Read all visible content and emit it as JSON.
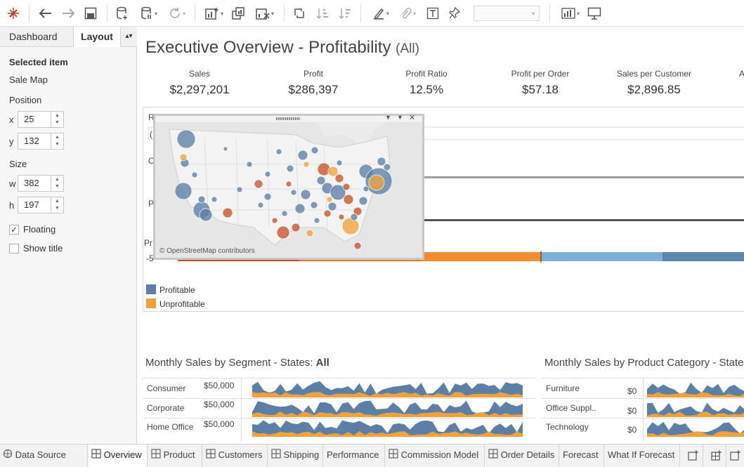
{
  "left_pane": {
    "tab_dashboard": "Dashboard",
    "tab_layout": "Layout",
    "selected_item_heading": "Selected item",
    "selected_item_value": "Sale Map",
    "position_heading": "Position",
    "x_label": "x",
    "x_value": "25",
    "y_label": "y",
    "y_value": "132",
    "size_heading": "Size",
    "w_label": "w",
    "w_value": "382",
    "h_label": "h",
    "h_value": "197",
    "floating_label": "Floating",
    "floating_checked": true,
    "show_title_label": "Show title",
    "show_title_checked": false
  },
  "dashboard": {
    "title": "Executive Overview - Profitability",
    "title_filter": "(All)",
    "kpis": [
      {
        "label": "Sales",
        "value": "$2,297,201"
      },
      {
        "label": "Profit",
        "value": "$286,397"
      },
      {
        "label": "Profit Ratio",
        "value": "12.5%"
      },
      {
        "label": "Profit per Order",
        "value": "$57.18"
      },
      {
        "label": "Sales per Customer",
        "value": "$2,896.85"
      }
    ],
    "map_attribution": "© OpenStreetMap contributors",
    "legend": [
      {
        "label": "Profitable",
        "color": "#5b7fa6"
      },
      {
        "label": "Unprofitable",
        "color": "#f0a23a"
      }
    ],
    "segment_section": {
      "title_prefix": "Monthly Sales by Segment - States: ",
      "title_bold": "All",
      "rows": [
        {
          "label": "Consumer",
          "axis": "$50,000"
        },
        {
          "label": "Corporate",
          "axis": "$50,000"
        },
        {
          "label": "Home Office",
          "axis": "$50,000"
        }
      ]
    },
    "category_section": {
      "title": "Monthly Sales by Product Category - States",
      "rows": [
        {
          "label": "Furniture",
          "axis": "$0"
        },
        {
          "label": "Office Suppl..",
          "axis": "$0"
        },
        {
          "label": "Technology",
          "axis": "$0"
        }
      ]
    },
    "colors": {
      "blue": "#5b7fa6",
      "orange": "#f0a23a",
      "dark_orange": "#c4532a"
    }
  },
  "bottom_tabs": [
    {
      "label": "Data Source",
      "icon": "data-source-icon"
    },
    {
      "label": "Overview",
      "icon": "dashboard-icon",
      "active": true
    },
    {
      "label": "Product",
      "icon": "dashboard-icon"
    },
    {
      "label": "Customers",
      "icon": "dashboard-icon"
    },
    {
      "label": "Shipping",
      "icon": "dashboard-icon"
    },
    {
      "label": "Performance",
      "icon": ""
    },
    {
      "label": "Commission Model",
      "icon": "dashboard-icon"
    },
    {
      "label": "Order Details",
      "icon": "dashboard-icon"
    },
    {
      "label": "Forecast",
      "icon": ""
    },
    {
      "label": "What If Forecast",
      "icon": ""
    }
  ]
}
